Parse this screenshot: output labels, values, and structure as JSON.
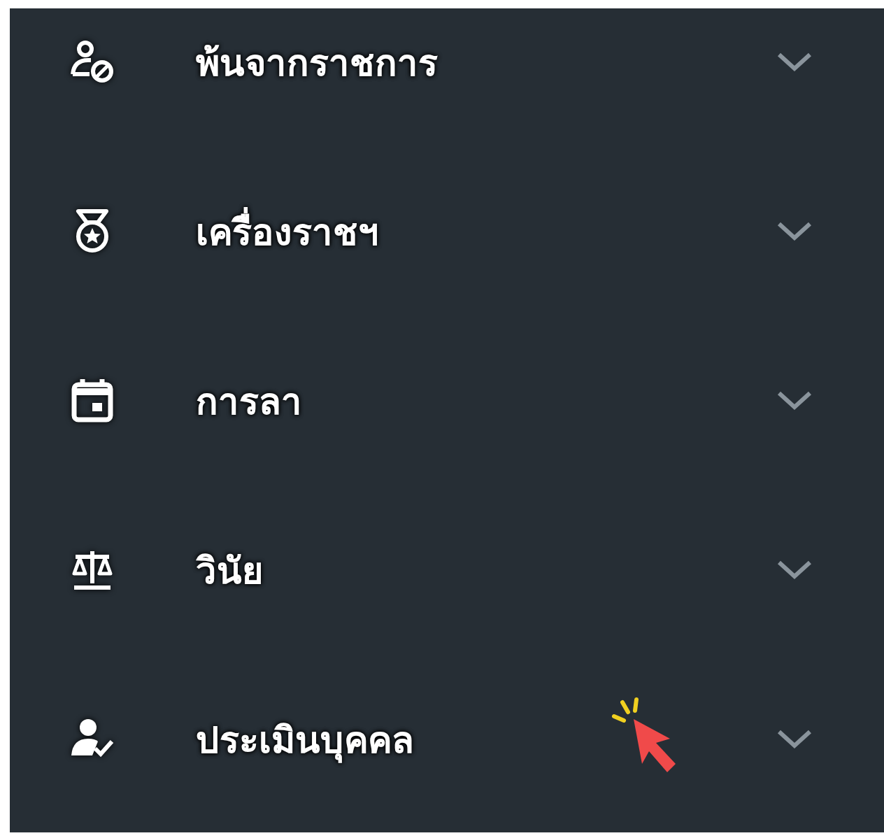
{
  "menu": {
    "items": [
      {
        "kind": "person-block",
        "label": "พ้นจากราชการ",
        "expanded": false
      },
      {
        "kind": "medal",
        "label": "เครื่องราชฯ",
        "expanded": false
      },
      {
        "kind": "calendar",
        "label": "การลา",
        "expanded": false
      },
      {
        "kind": "scales",
        "label": "วินัย",
        "expanded": false
      },
      {
        "kind": "person-check",
        "label": "ประเมินบุคคล",
        "expanded": false,
        "pointer": true
      }
    ]
  }
}
